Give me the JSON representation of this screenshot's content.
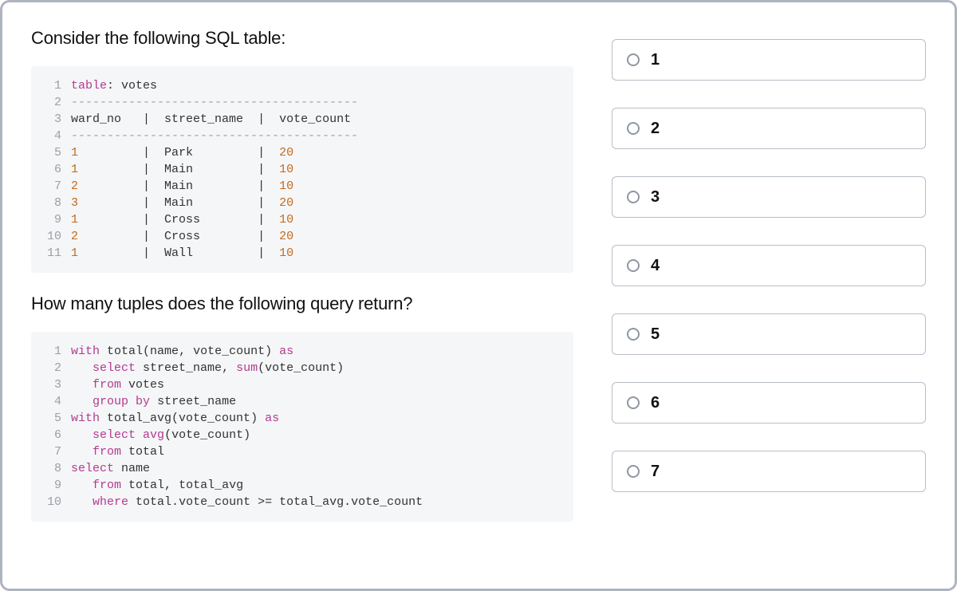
{
  "question": {
    "intro": "Consider the following SQL table:",
    "prompt": "How many tuples does the following query return?"
  },
  "table_block": {
    "lines": [
      [
        {
          "t": "kw",
          "v": "table"
        },
        {
          "t": "punc",
          "v": ": "
        },
        {
          "t": "id",
          "v": "votes"
        }
      ],
      [
        {
          "t": "dash",
          "v": "----------------------------------------"
        }
      ],
      [
        {
          "t": "id",
          "v": "ward_no   "
        },
        {
          "t": "punc",
          "v": "|  "
        },
        {
          "t": "id",
          "v": "street_name  "
        },
        {
          "t": "punc",
          "v": "|  "
        },
        {
          "t": "id",
          "v": "vote_count"
        }
      ],
      [
        {
          "t": "dash",
          "v": "----------------------------------------"
        }
      ],
      [
        {
          "t": "num",
          "v": "1         "
        },
        {
          "t": "punc",
          "v": "|  "
        },
        {
          "t": "id",
          "v": "Park         "
        },
        {
          "t": "punc",
          "v": "|  "
        },
        {
          "t": "num",
          "v": "20"
        }
      ],
      [
        {
          "t": "num",
          "v": "1         "
        },
        {
          "t": "punc",
          "v": "|  "
        },
        {
          "t": "id",
          "v": "Main         "
        },
        {
          "t": "punc",
          "v": "|  "
        },
        {
          "t": "num",
          "v": "10"
        }
      ],
      [
        {
          "t": "num",
          "v": "2         "
        },
        {
          "t": "punc",
          "v": "|  "
        },
        {
          "t": "id",
          "v": "Main         "
        },
        {
          "t": "punc",
          "v": "|  "
        },
        {
          "t": "num",
          "v": "10"
        }
      ],
      [
        {
          "t": "num",
          "v": "3         "
        },
        {
          "t": "punc",
          "v": "|  "
        },
        {
          "t": "id",
          "v": "Main         "
        },
        {
          "t": "punc",
          "v": "|  "
        },
        {
          "t": "num",
          "v": "20"
        }
      ],
      [
        {
          "t": "num",
          "v": "1         "
        },
        {
          "t": "punc",
          "v": "|  "
        },
        {
          "t": "id",
          "v": "Cross        "
        },
        {
          "t": "punc",
          "v": "|  "
        },
        {
          "t": "num",
          "v": "10"
        }
      ],
      [
        {
          "t": "num",
          "v": "2         "
        },
        {
          "t": "punc",
          "v": "|  "
        },
        {
          "t": "id",
          "v": "Cross        "
        },
        {
          "t": "punc",
          "v": "|  "
        },
        {
          "t": "num",
          "v": "20"
        }
      ],
      [
        {
          "t": "num",
          "v": "1         "
        },
        {
          "t": "punc",
          "v": "|  "
        },
        {
          "t": "id",
          "v": "Wall         "
        },
        {
          "t": "punc",
          "v": "|  "
        },
        {
          "t": "num",
          "v": "10"
        }
      ]
    ]
  },
  "query_block": {
    "lines": [
      [
        {
          "t": "kw",
          "v": "with"
        },
        {
          "t": "id",
          "v": " total"
        },
        {
          "t": "punc",
          "v": "("
        },
        {
          "t": "id",
          "v": "name"
        },
        {
          "t": "punc",
          "v": ", "
        },
        {
          "t": "id",
          "v": "vote_count"
        },
        {
          "t": "punc",
          "v": ") "
        },
        {
          "t": "kw",
          "v": "as"
        }
      ],
      [
        {
          "t": "id",
          "v": "   "
        },
        {
          "t": "kw",
          "v": "select"
        },
        {
          "t": "id",
          "v": " street_name"
        },
        {
          "t": "punc",
          "v": ", "
        },
        {
          "t": "kw",
          "v": "sum"
        },
        {
          "t": "punc",
          "v": "("
        },
        {
          "t": "id",
          "v": "vote_count"
        },
        {
          "t": "punc",
          "v": ")"
        }
      ],
      [
        {
          "t": "id",
          "v": "   "
        },
        {
          "t": "kw",
          "v": "from"
        },
        {
          "t": "id",
          "v": " votes"
        }
      ],
      [
        {
          "t": "id",
          "v": "   "
        },
        {
          "t": "kw",
          "v": "group"
        },
        {
          "t": "id",
          "v": " "
        },
        {
          "t": "kw",
          "v": "by"
        },
        {
          "t": "id",
          "v": " street_name"
        }
      ],
      [
        {
          "t": "kw",
          "v": "with"
        },
        {
          "t": "id",
          "v": " total_avg"
        },
        {
          "t": "punc",
          "v": "("
        },
        {
          "t": "id",
          "v": "vote_count"
        },
        {
          "t": "punc",
          "v": ") "
        },
        {
          "t": "kw",
          "v": "as"
        }
      ],
      [
        {
          "t": "id",
          "v": "   "
        },
        {
          "t": "kw",
          "v": "select"
        },
        {
          "t": "id",
          "v": " "
        },
        {
          "t": "kw",
          "v": "avg"
        },
        {
          "t": "punc",
          "v": "("
        },
        {
          "t": "id",
          "v": "vote_count"
        },
        {
          "t": "punc",
          "v": ")"
        }
      ],
      [
        {
          "t": "id",
          "v": "   "
        },
        {
          "t": "kw",
          "v": "from"
        },
        {
          "t": "id",
          "v": " total"
        }
      ],
      [
        {
          "t": "kw",
          "v": "select"
        },
        {
          "t": "id",
          "v": " name"
        }
      ],
      [
        {
          "t": "id",
          "v": "   "
        },
        {
          "t": "kw",
          "v": "from"
        },
        {
          "t": "id",
          "v": " total"
        },
        {
          "t": "punc",
          "v": ", "
        },
        {
          "t": "id",
          "v": "total_avg"
        }
      ],
      [
        {
          "t": "id",
          "v": "   "
        },
        {
          "t": "kw",
          "v": "where"
        },
        {
          "t": "id",
          "v": " total"
        },
        {
          "t": "punc",
          "v": "."
        },
        {
          "t": "id",
          "v": "vote_count "
        },
        {
          "t": "punc",
          "v": ">="
        },
        {
          "t": "id",
          "v": " total_avg"
        },
        {
          "t": "punc",
          "v": "."
        },
        {
          "t": "id",
          "v": "vote_count"
        }
      ]
    ]
  },
  "options": [
    {
      "label": "1"
    },
    {
      "label": "2"
    },
    {
      "label": "3"
    },
    {
      "label": "4"
    },
    {
      "label": "5"
    },
    {
      "label": "6"
    },
    {
      "label": "7"
    }
  ]
}
